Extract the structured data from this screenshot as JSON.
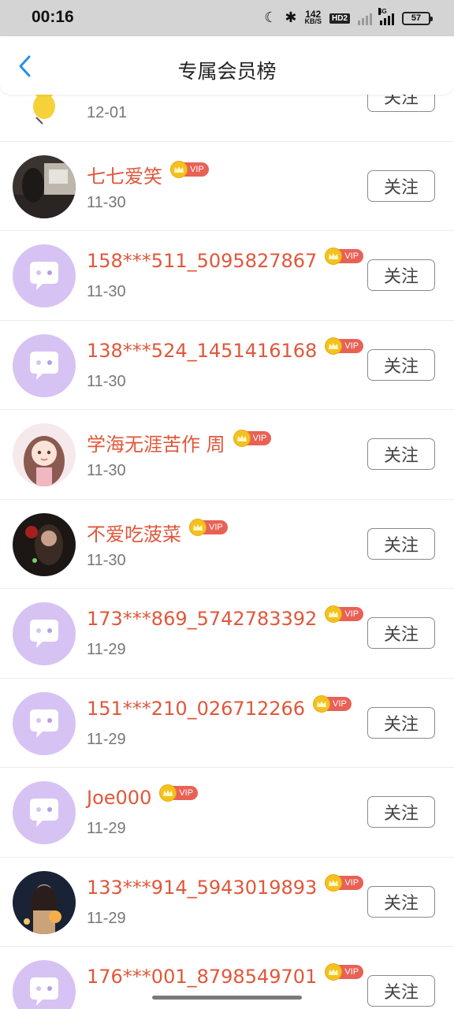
{
  "status_bar": {
    "time": "00:16",
    "net_speed_value": "142",
    "net_speed_unit": "KB/S",
    "hd_label": "HD2",
    "network_label": "4G",
    "battery": "57"
  },
  "header": {
    "title": "专属会员榜"
  },
  "vip_label": "VIP",
  "follow_label": "关注",
  "members": [
    {
      "name": "",
      "date": "12-01",
      "avatar": "chick-avatar"
    },
    {
      "name": "七七爱笑",
      "date": "11-30",
      "avatar": "photo-avatar-room"
    },
    {
      "name": "158***511_5095827867",
      "date": "11-30",
      "avatar": "default-chat-avatar"
    },
    {
      "name": "138***524_1451416168",
      "date": "11-30",
      "avatar": "default-chat-avatar"
    },
    {
      "name": "学海无涯苦作 周",
      "date": "11-30",
      "avatar": "photo-avatar-illustrated-girl"
    },
    {
      "name": "不爱吃菠菜",
      "date": "11-30",
      "avatar": "photo-avatar-rose"
    },
    {
      "name": "173***869_5742783392",
      "date": "11-29",
      "avatar": "default-chat-avatar"
    },
    {
      "name": "151***210_026712266",
      "date": "11-29",
      "avatar": "default-chat-avatar"
    },
    {
      "name": "Joe000",
      "date": "11-29",
      "avatar": "default-chat-avatar"
    },
    {
      "name": "133***914_5943019893",
      "date": "11-29",
      "avatar": "photo-avatar-lantern"
    },
    {
      "name": "176***001_8798549701",
      "date": "",
      "avatar": "default-chat-avatar"
    }
  ],
  "colors": {
    "name": "#e0573a",
    "vip_tag": "#e96156",
    "crown": "#f3c21f",
    "default_avatar_bg": "#d7c2f4",
    "back_arrow": "#2a8fe0"
  }
}
